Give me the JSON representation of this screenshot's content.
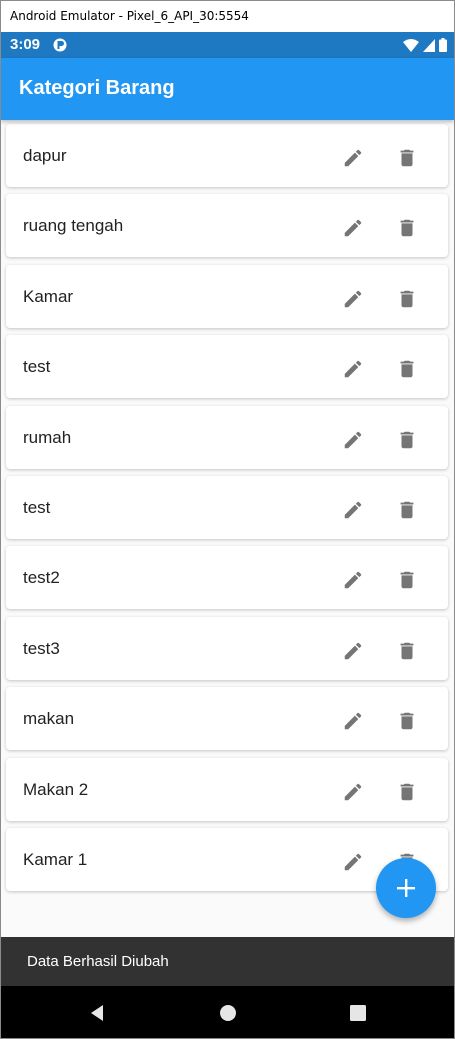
{
  "window": {
    "title": "Android Emulator - Pixel_6_API_30:5554"
  },
  "status_bar": {
    "time": "3:09",
    "icons": [
      "wifi-icon",
      "signal-icon",
      "battery-icon"
    ]
  },
  "app_bar": {
    "title": "Kategori Barang",
    "color": "#2196f3"
  },
  "categories": [
    {
      "name": "dapur"
    },
    {
      "name": "ruang tengah"
    },
    {
      "name": "Kamar"
    },
    {
      "name": "test"
    },
    {
      "name": "rumah"
    },
    {
      "name": "test"
    },
    {
      "name": "test2"
    },
    {
      "name": "test3"
    },
    {
      "name": "makan"
    },
    {
      "name": "Makan 2"
    },
    {
      "name": "Kamar 1"
    }
  ],
  "row_actions": [
    "edit-icon",
    "delete-icon"
  ],
  "fab": {
    "icon": "add-icon"
  },
  "snackbar": {
    "message": "Data Berhasil Diubah"
  },
  "nav_bar": {
    "buttons": [
      "back-icon",
      "home-icon",
      "recents-icon"
    ]
  }
}
